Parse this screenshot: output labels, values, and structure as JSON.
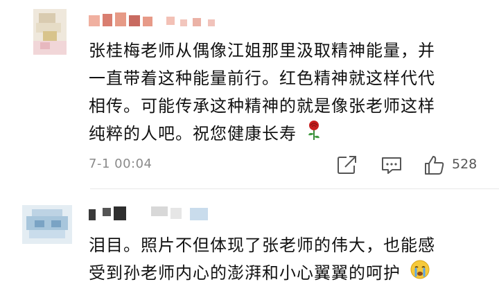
{
  "comments": [
    {
      "text_lines": [
        "张桂梅老师从偶像江姐那里汲取精神能量，并",
        "一直带着这种能量前行。红色精神就这样代代",
        "相传。可能传承这种精神的就是像张老师这样",
        "纯粹的人吧。祝您健康长寿"
      ],
      "emoji": "rose-emoji",
      "timestamp": "7-1 00:04",
      "likes": "528",
      "icons": [
        "share-icon",
        "reply-icon",
        "like-icon"
      ]
    },
    {
      "text_lines": [
        "泪目。照片不但体现了张老师的伟大，也能感",
        "受到孙老师内心的澎湃和小心翼翼的呵护"
      ],
      "emoji": "crying-emoji"
    }
  ],
  "colors": {
    "text": "#111111",
    "meta": "#8a8a8a",
    "divider": "#e8e8e8"
  }
}
